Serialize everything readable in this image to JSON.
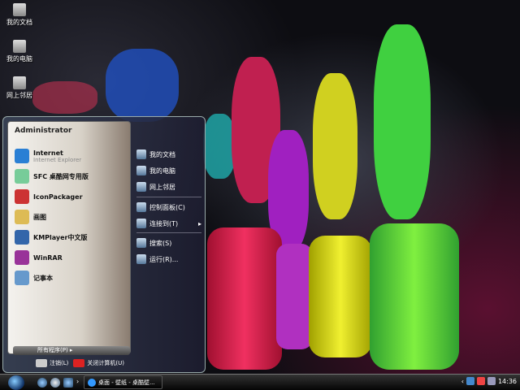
{
  "desktop": {
    "icons": [
      {
        "label": "我的文档",
        "icon": "documents-icon"
      },
      {
        "label": "我的电脑",
        "icon": "computer-icon"
      },
      {
        "label": "网上邻居",
        "icon": "network-icon"
      }
    ]
  },
  "start_menu": {
    "user": "Administrator",
    "left_items": [
      {
        "label": "Internet",
        "sub": "Internet Explorer",
        "icon": "internet-explorer-icon",
        "color": "#2a7fd4"
      },
      {
        "label": "SFC 桌酷网专用版",
        "icon": "sfc-icon",
        "color": "#7c9"
      },
      {
        "label": "IconPackager",
        "icon": "iconpackager-icon",
        "color": "#c33"
      },
      {
        "label": "画图",
        "icon": "paint-icon",
        "color": "#db5"
      },
      {
        "label": "KMPlayer中文版",
        "icon": "kmplayer-icon",
        "color": "#36a"
      },
      {
        "label": "WinRAR",
        "icon": "winrar-icon",
        "color": "#939"
      },
      {
        "label": "记事本",
        "icon": "notepad-icon",
        "color": "#69c"
      }
    ],
    "all_programs": "所有程序(P)",
    "right_items": [
      {
        "label": "我的文档",
        "icon": "documents-icon"
      },
      {
        "label": "我的电脑",
        "icon": "computer-icon"
      },
      {
        "label": "网上邻居",
        "icon": "network-icon"
      },
      {
        "label": "控制面板(C)",
        "icon": "control-panel-icon"
      },
      {
        "label": "连接到(T)",
        "icon": "connect-icon",
        "arrow": "▸"
      },
      {
        "label": "搜索(S)",
        "icon": "search-icon"
      },
      {
        "label": "运行(R)...",
        "icon": "run-icon"
      }
    ],
    "logoff": "注销(L)",
    "shutdown": "关闭计算机(U)"
  },
  "taskbar": {
    "task": "桌面 - 壁纸 - 桌酷壁...",
    "clock": "14:36",
    "chevron": "›"
  }
}
